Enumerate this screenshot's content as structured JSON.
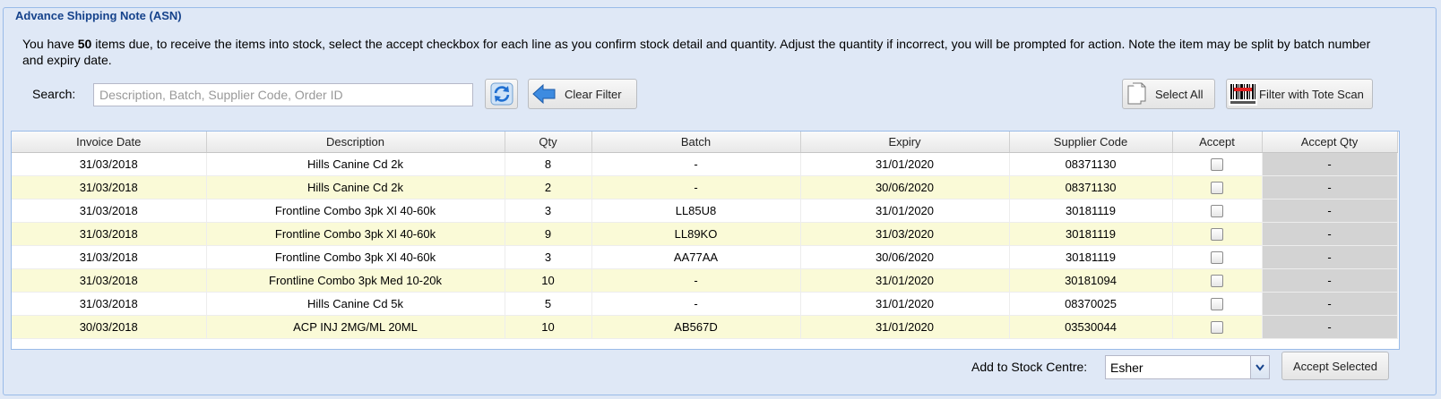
{
  "panel": {
    "title": "Advance Shipping Note (ASN)"
  },
  "intro": {
    "prefix": "You have ",
    "count": "50",
    "suffix": " items due, to receive the items into stock, select the accept checkbox for each line as you confirm stock detail and quantity. Adjust the quantity if incorrect, you will be prompted for action. Note the item may be split by batch number and expiry date."
  },
  "search": {
    "label": "Search:",
    "placeholder": "Description, Batch, Supplier Code, Order ID",
    "value": ""
  },
  "toolbar": {
    "refresh_icon": "refresh-icon",
    "clear_filter_label": "Clear Filter",
    "select_all_label": "Select All",
    "tote_scan_label": "Filter with Tote Scan"
  },
  "grid": {
    "columns": [
      "Invoice Date",
      "Description",
      "Qty",
      "Batch",
      "Expiry",
      "Supplier Code",
      "Accept",
      "Accept Qty"
    ],
    "rows": [
      {
        "invoice_date": "31/03/2018",
        "description": "Hills Canine Cd 2k",
        "qty": "8",
        "batch": "-",
        "expiry": "31/01/2020",
        "supplier_code": "08371130",
        "accept": false,
        "accept_qty": "-"
      },
      {
        "invoice_date": "31/03/2018",
        "description": "Hills Canine Cd 2k",
        "qty": "2",
        "batch": "-",
        "expiry": "30/06/2020",
        "supplier_code": "08371130",
        "accept": false,
        "accept_qty": "-"
      },
      {
        "invoice_date": "31/03/2018",
        "description": "Frontline Combo 3pk Xl 40-60k",
        "qty": "3",
        "batch": "LL85U8",
        "expiry": "31/01/2020",
        "supplier_code": "30181119",
        "accept": false,
        "accept_qty": "-"
      },
      {
        "invoice_date": "31/03/2018",
        "description": "Frontline Combo 3pk Xl 40-60k",
        "qty": "9",
        "batch": "LL89KO",
        "expiry": "31/03/2020",
        "supplier_code": "30181119",
        "accept": false,
        "accept_qty": "-"
      },
      {
        "invoice_date": "31/03/2018",
        "description": "Frontline Combo 3pk Xl 40-60k",
        "qty": "3",
        "batch": "AA77AA",
        "expiry": "30/06/2020",
        "supplier_code": "30181119",
        "accept": false,
        "accept_qty": "-"
      },
      {
        "invoice_date": "31/03/2018",
        "description": "Frontline Combo 3pk Med 10-20k",
        "qty": "10",
        "batch": "-",
        "expiry": "31/01/2020",
        "supplier_code": "30181094",
        "accept": false,
        "accept_qty": "-"
      },
      {
        "invoice_date": "31/03/2018",
        "description": "Hills Canine Cd 5k",
        "qty": "5",
        "batch": "-",
        "expiry": "31/01/2020",
        "supplier_code": "08370025",
        "accept": false,
        "accept_qty": "-"
      },
      {
        "invoice_date": "30/03/2018",
        "description": "ACP INJ 2MG/ML 20ML",
        "qty": "10",
        "batch": "AB567D",
        "expiry": "31/01/2020",
        "supplier_code": "03530044",
        "accept": false,
        "accept_qty": "-"
      }
    ]
  },
  "footer": {
    "stock_centre_label": "Add to Stock Centre:",
    "stock_centre_value": "Esher",
    "accept_selected_label": "Accept Selected"
  },
  "colors": {
    "panel_bg": "#dfe8f6",
    "title": "#15428b",
    "alt_row": "#fafad7",
    "accept_qty_cell": "#d3d3d3"
  }
}
